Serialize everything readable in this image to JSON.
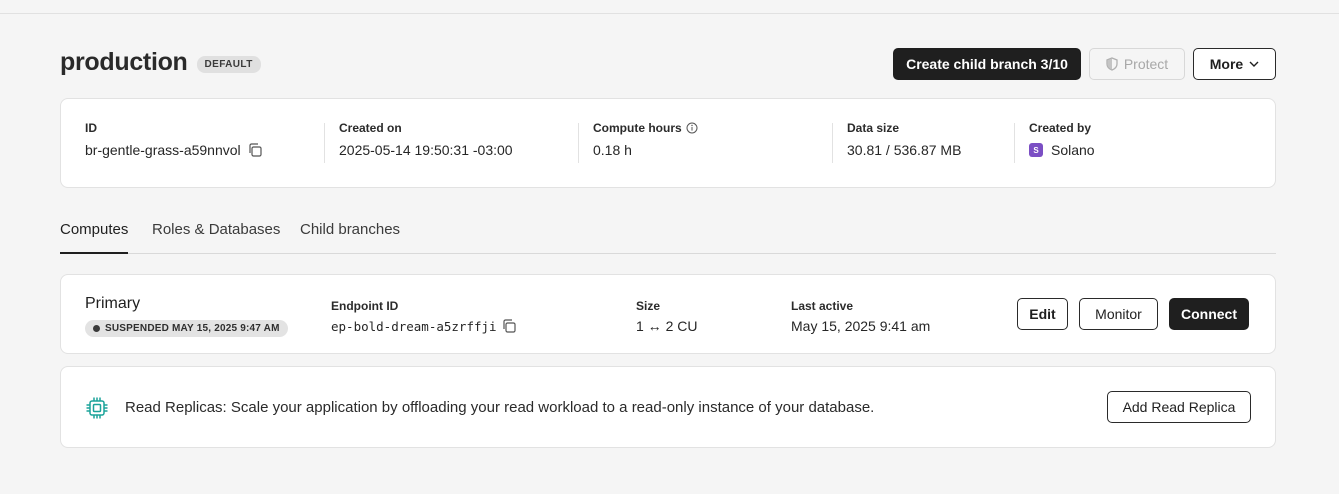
{
  "branch": {
    "name": "production",
    "badge": "DEFAULT"
  },
  "header_actions": {
    "create_child": "Create child branch 3/10",
    "protect": "Protect",
    "more": "More"
  },
  "info": {
    "id_label": "ID",
    "id_value": "br-gentle-grass-a59nnvol",
    "created_on_label": "Created on",
    "created_on_value": "2025-05-14 19:50:31 -03:00",
    "compute_hours_label": "Compute hours",
    "compute_hours_value": "0.18 h",
    "data_size_label": "Data size",
    "data_size_value": "30.81 / 536.87 MB",
    "created_by_label": "Created by",
    "created_by_initial": "S",
    "created_by_value": "Solano",
    "avatar_color": "#7b4fc4"
  },
  "tabs": [
    {
      "label": "Computes",
      "active": true
    },
    {
      "label": "Roles & Databases",
      "active": false
    },
    {
      "label": "Child branches",
      "active": false
    }
  ],
  "compute": {
    "title": "Primary",
    "status": "SUSPENDED MAY 15, 2025 9:47 AM",
    "endpoint_label": "Endpoint ID",
    "endpoint_value": "ep-bold-dream-a5zrffji",
    "size_label": "Size",
    "size_value": "1 ↔ 2 CU",
    "last_active_label": "Last active",
    "last_active_value": "May 15, 2025 9:41 am",
    "actions": {
      "edit": "Edit",
      "monitor": "Monitor",
      "connect": "Connect"
    }
  },
  "replicas": {
    "text": "Read Replicas: Scale your application by offloading your read workload to a read-only instance of your database.",
    "button": "Add Read Replica",
    "icon": "chip-icon",
    "icon_color": "#1aa39a"
  }
}
